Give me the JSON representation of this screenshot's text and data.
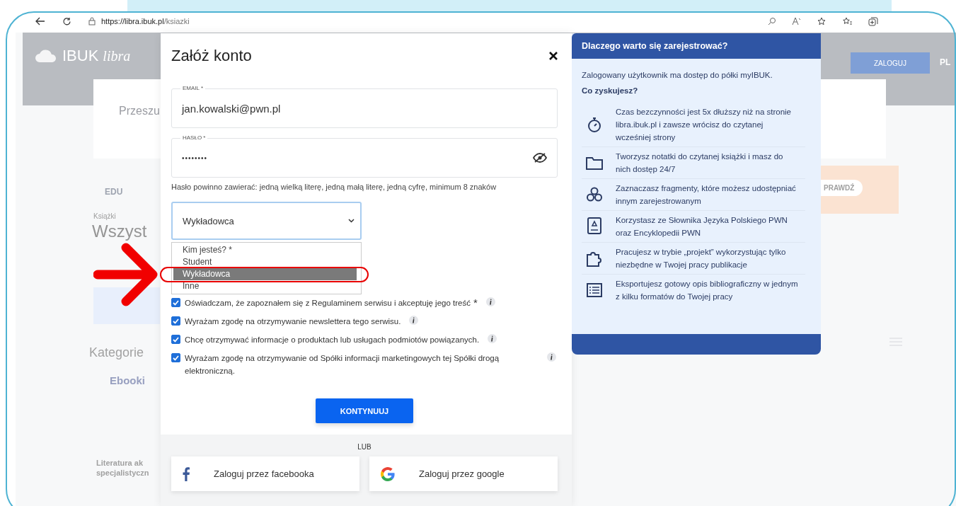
{
  "browser": {
    "url_host": "https://libra.ibuk.pl",
    "url_path": "/ksiazki"
  },
  "background_page": {
    "logo_text": "IBUK",
    "logo_script": "libra",
    "login": "ZALOGUJ",
    "language": "PL",
    "search_hint": "Przeszu",
    "check_button": "PRAWDŹ",
    "edu": "EDU",
    "section": "Książki",
    "heading": "Wszyst",
    "categories": "Kategorie",
    "tab": "Ebooki",
    "category_lines": [
      "Literatura ak",
      "specjalistyczn"
    ]
  },
  "modal": {
    "title": "Załóż konto",
    "email": {
      "label": "EMAIL *",
      "value": "jan.kowalski@pwn.pl"
    },
    "password": {
      "label": "HASŁO *",
      "value": "••••••••"
    },
    "password_hint": "Hasło powinno zawierać: jedną wielką literę, jedną małą literę, jedną cyfrę, minimum 8 znaków",
    "role_select": {
      "value": "Wykładowca",
      "expanded": true,
      "options": [
        {
          "label": "Kim jesteś? *",
          "selected": false
        },
        {
          "label": "Student",
          "selected": false
        },
        {
          "label": "Wykładowca",
          "selected": true
        },
        {
          "label": "Inne",
          "selected": false
        }
      ]
    },
    "consents": [
      {
        "text": "Oświadczam, że zapoznałem się z Regulaminem serwisu i akceptuję jego treść",
        "required": true,
        "checked": true
      },
      {
        "text": "Wyrażam zgodę na otrzymywanie newslettera tego serwisu.",
        "required": false,
        "checked": true
      },
      {
        "text": "Chcę otrzymywać informacje o produktach lub usługach podmiotów powiązanych.",
        "required": false,
        "checked": true
      },
      {
        "text": "Wyrażam zgodę na otrzymywanie od Spółki informacji marketingowych tej Spółki drogą elektroniczną.",
        "required": false,
        "checked": true
      }
    ],
    "required_mark": "*",
    "submit": "KONTYNUUJ",
    "or": "LUB",
    "social": [
      "Zaloguj przez facebooka",
      "Zaloguj przez google"
    ]
  },
  "benefits": {
    "title": "Dlaczego warto się zarejestrować?",
    "intro": "Zalogowany użytkownik ma dostęp do półki myIBUK.",
    "question": "Co zyskujesz?",
    "items": [
      "Czas bezczynności jest 5x dłuższy niż na stronie libra.ibuk.pl i zawsze wrócisz do czytanej wcześniej strony",
      "Tworzysz notatki do czytanej książki i masz do nich dostęp 24/7",
      "Zaznaczasz fragmenty, które możesz udostępniać innym zarejestrowanym",
      "Korzystasz ze Słownika Języka Polskiego PWN oraz Encyklopedii PWN",
      "Pracujesz w trybie „projekt” wykorzystując tylko niezbędne w Twojej pracy publikacje",
      "Eksportujesz gotowy opis bibliograficzny w jednym z kilku formatów do Twojej pracy"
    ]
  }
}
